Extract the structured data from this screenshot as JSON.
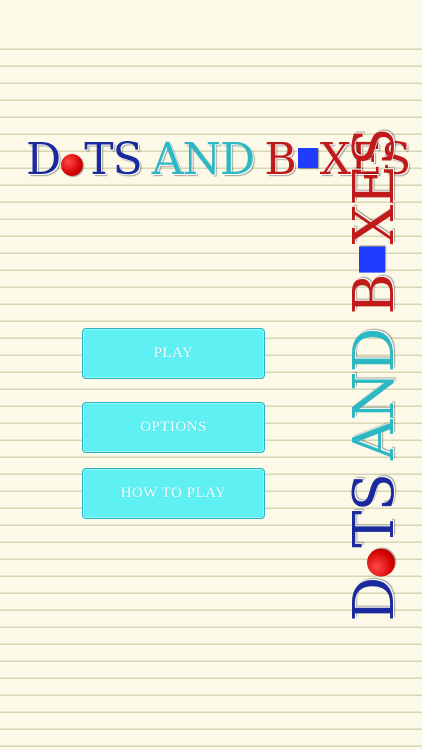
{
  "title": {
    "word1_first": "D",
    "word1_rest": "TS",
    "word2": "AND",
    "word3_first": "B",
    "word3_rest": "XES"
  },
  "menu": {
    "play_label": "PLAY",
    "options_label": "OPTIONS",
    "how_to_play_label": "HOW TO PLAY"
  },
  "icons": {
    "dot": "red-dot-icon",
    "box": "blue-box-icon"
  },
  "colors": {
    "navy": "#1a2a9e",
    "teal": "#2bb8c2",
    "red": "#c11a1a",
    "button": "#5ff0f4",
    "paper": "#fcf9e8",
    "rule_line": "#d6d7b4"
  }
}
